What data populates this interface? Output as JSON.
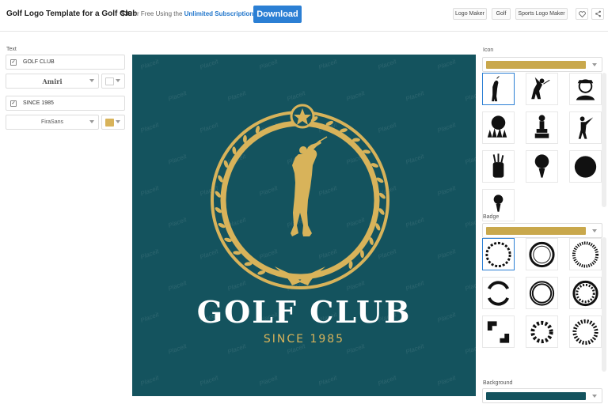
{
  "header": {
    "title": "Golf Logo Template for a Golf Club",
    "price": "$39",
    "price_rest": " or Free Using the ",
    "subscription_link": "Unlimited Subscription",
    "download_label": "Download",
    "tags": [
      "Logo Maker",
      "Golf",
      "Sports Logo Maker"
    ],
    "heart_icon": "heart-icon",
    "share_icon": "share-icon"
  },
  "left_panel": {
    "section_label": "Text",
    "line1": {
      "text": "GOLF CLUB",
      "checked": true,
      "font": "Amiri",
      "color": "#ffffff"
    },
    "line2": {
      "text": "SINCE 1985",
      "checked": true,
      "font": "FiraSans",
      "color": "#d8b35a"
    }
  },
  "canvas": {
    "watermark": "Placeit",
    "logo_title": "GOLF CLUB",
    "logo_subtitle": "SINCE 1985",
    "background_color": "#14535e",
    "accent_color": "#d8b35a"
  },
  "right_panel": {
    "icon_label": "Icon",
    "icon_color": "#c9a84c",
    "badge_label": "Badge",
    "badge_color": "#c9a84c",
    "background_label": "Background",
    "background_color": "#14535e",
    "icons": [
      "golfer-icon",
      "golfer-swing-icon",
      "golfer-cap-icon",
      "golf-ball-grass-icon",
      "golf-trophy-icon",
      "golfer-drive-icon",
      "golf-bag-icon",
      "golf-ball-tee-icon",
      "golf-ball-icon",
      "golf-tee-icon"
    ],
    "badges": [
      "laurel-badge",
      "ring-badge",
      "dotted-ring-badge",
      "double-ring-badge",
      "frame-badge",
      "wreath-badge",
      "square-corners-badge",
      "gear-badge",
      "laurel-ring-badge"
    ]
  }
}
